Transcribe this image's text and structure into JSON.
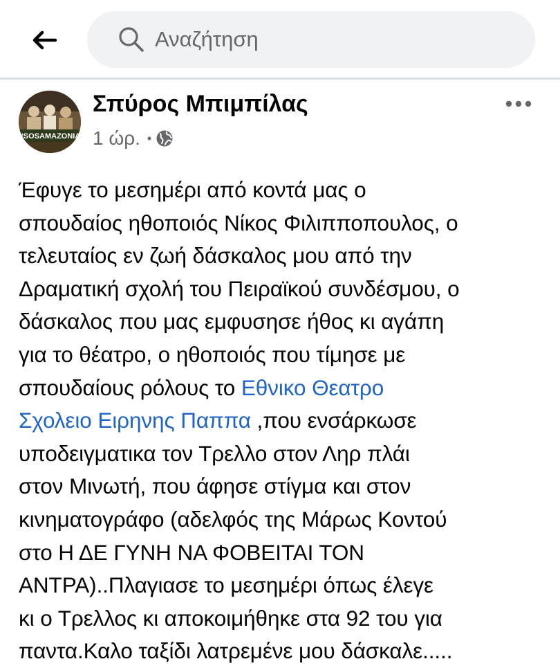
{
  "header": {
    "back_icon": "arrow-left-icon",
    "search": {
      "icon": "search-icon",
      "placeholder": "Αναζήτηση"
    }
  },
  "post": {
    "author": "Σπύρος Μπιμπίλας",
    "avatar_text": "#SOSAMAZONIA",
    "time": "1 ώρ.",
    "separator": "•",
    "privacy_icon": "globe-icon",
    "more_icon": "more-horizontal-icon",
    "body": {
      "line1": "Έφυγε το μεσημέρι από κοντά μας ο",
      "line2": "σπουδαίος ηθοποιός Νίκος Φιλιπποπουλος, ο",
      "line3": "τελευταίος εν ζωή δάσκαλος μου από την",
      "line4": "Δραματική σχολή του Πειραϊκού συνδέσμου, ο",
      "line5": "δάσκαλος που μας εμφυσησε ήθος κι αγάπη",
      "line6": "για το θέατρο, ο ηθοποιός που τίμησε με",
      "line7_prefix": "σπουδαίους ρόλους το ",
      "link1": "Εθνικο Θεατρο",
      "link2": "Σχολειο Ειρηνης Παππα",
      "line8_suffix": " ,που ενσάρκωσε",
      "line9": "υποδειγματικα τον Τρελλο στον Ληρ πλάι",
      "line10": "στον Μινωτή, που άφησε στίγμα και στον",
      "line11": "κινηματογράφο (αδελφός της Μάρως Κοντού",
      "line12": "στο Η ΔΕ ΓΥΝΗ ΝΑ ΦΟΒΕΙΤΑΙ ΤΟΝ",
      "line13": "ΑΝΤΡΑ)..Πλαγιασε το μεσημέρι όπως έλεγε",
      "line14": "κι ο Τρελλος κι αποκοιμήθηκε στα 92 του για",
      "line15": "παντα.Καλο ταξίδι λατρεμένε μου δάσκαλε....."
    }
  },
  "colors": {
    "link": "#2065c4",
    "secondary_text": "#65676b",
    "search_bg": "#f0f2f5"
  }
}
